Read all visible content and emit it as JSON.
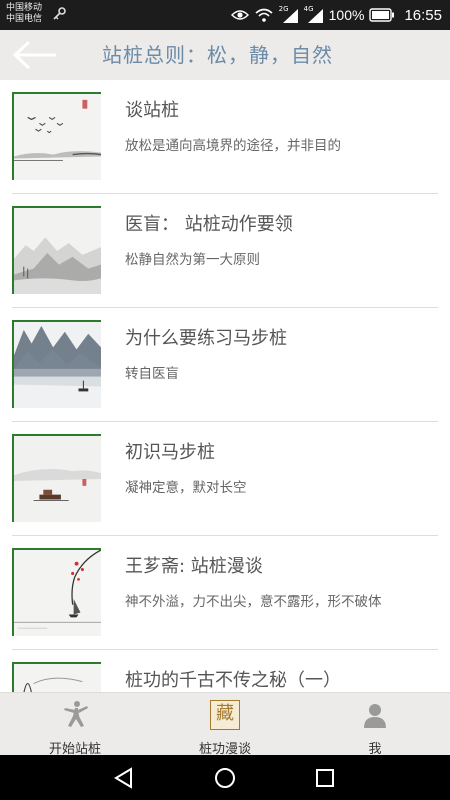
{
  "status_bar": {
    "carrier_1": "中国移动",
    "carrier_2": "中国电信",
    "network_1": "2G",
    "network_2": "4G",
    "battery": "100%",
    "time": "16:55"
  },
  "header": {
    "title": "站桩总则：松，静，自然",
    "back_icon": "arrow-left-icon"
  },
  "articles": [
    {
      "title": "谈站桩",
      "subtitle": "放松是通向高境界的途径，并非目的"
    },
    {
      "title": "医盲：  站桩动作要领",
      "subtitle": "松静自然为第一大原则"
    },
    {
      "title": "为什么要练习马步桩",
      "subtitle": "转自医盲"
    },
    {
      "title": "初识马步桩",
      "subtitle": "凝神定意，默对长空"
    },
    {
      "title": "王芗斋: 站桩漫谈",
      "subtitle": "神不外溢，力不出尖，意不露形，形不破体"
    },
    {
      "title": "桩功的千古不传之秘（一）",
      "subtitle": ""
    }
  ],
  "tabs": [
    {
      "label": "开始站桩",
      "icon": "martial-arts-figure-icon"
    },
    {
      "label": "桩功漫谈",
      "icon": "cang-seal-icon",
      "seal_char": "藏"
    },
    {
      "label": "我",
      "icon": "user-icon"
    }
  ],
  "colors": {
    "title_blue": "#6b8ba8",
    "thumb_border": "#2c7a2c",
    "seal_gold": "#a47a2e"
  }
}
